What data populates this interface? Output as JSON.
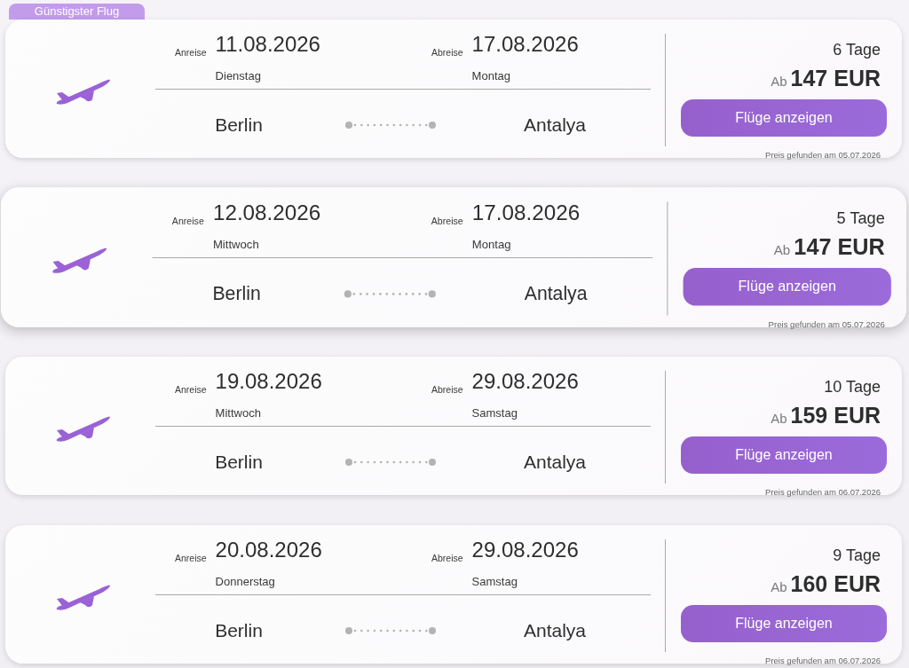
{
  "flights": [
    {
      "badge": "Günstigster Flug",
      "hovered": false,
      "outbound": {
        "label": "Anreise",
        "date": "11.08.2026",
        "weekday": "Dienstag"
      },
      "return": {
        "label": "Abreise",
        "date": "17.08.2026",
        "weekday": "Montag"
      },
      "origin": "Berlin",
      "destination": "Antalya",
      "duration": "6 Tage",
      "price_prefix": "Ab",
      "price": "147 EUR",
      "button": "Flüge anzeigen",
      "found": "Preis gefunden am 05.07.2026"
    },
    {
      "hovered": true,
      "outbound": {
        "label": "Anreise",
        "date": "12.08.2026",
        "weekday": "Mittwoch"
      },
      "return": {
        "label": "Abreise",
        "date": "17.08.2026",
        "weekday": "Montag"
      },
      "origin": "Berlin",
      "destination": "Antalya",
      "duration": "5 Tage",
      "price_prefix": "Ab",
      "price": "147 EUR",
      "button": "Flüge anzeigen",
      "found": "Preis gefunden am 05.07.2026"
    },
    {
      "hovered": false,
      "outbound": {
        "label": "Anreise",
        "date": "19.08.2026",
        "weekday": "Mittwoch"
      },
      "return": {
        "label": "Abreise",
        "date": "29.08.2026",
        "weekday": "Samstag"
      },
      "origin": "Berlin",
      "destination": "Antalya",
      "duration": "10 Tage",
      "price_prefix": "Ab",
      "price": "159 EUR",
      "button": "Flüge anzeigen",
      "found": "Preis gefunden am 06.07.2026"
    },
    {
      "hovered": false,
      "outbound": {
        "label": "Anreise",
        "date": "20.08.2026",
        "weekday": "Donnerstag"
      },
      "return": {
        "label": "Abreise",
        "date": "29.08.2026",
        "weekday": "Samstag"
      },
      "origin": "Berlin",
      "destination": "Antalya",
      "duration": "9 Tage",
      "price_prefix": "Ab",
      "price": "160 EUR",
      "button": "Flüge anzeigen",
      "found": "Preis gefunden am 06.07.2026"
    }
  ]
}
